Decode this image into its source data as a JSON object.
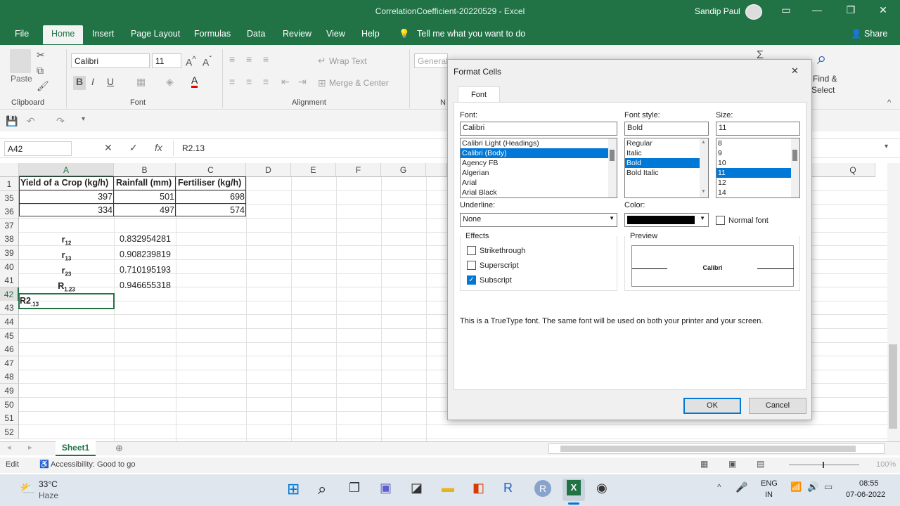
{
  "window": {
    "title": "CorrelationCoefficient-20220529  -  Excel",
    "user": "Sandip Paul"
  },
  "menu": {
    "tabs": [
      "File",
      "Home",
      "Insert",
      "Page Layout",
      "Formulas",
      "Data",
      "Review",
      "View",
      "Help"
    ],
    "tell_me": "Tell me what you want to do",
    "share": "Share"
  },
  "ribbon": {
    "paste": "Paste",
    "font_name": "Calibri",
    "font_size": "11",
    "wrap_text": "Wrap Text",
    "merge_center": "Merge & Center",
    "number_format": "General",
    "find_select_1": "Find &",
    "find_select_2": "Select",
    "groups": {
      "clipboard": "Clipboard",
      "font": "Font",
      "alignment": "Alignment",
      "number": "N"
    }
  },
  "formula_bar": {
    "name_box": "A42",
    "fx": "fx",
    "content": "R2.13"
  },
  "grid": {
    "columns": [
      "A",
      "B",
      "C",
      "D",
      "E",
      "F",
      "G",
      "Q"
    ],
    "row_numbers": [
      "1",
      "35",
      "36",
      "37",
      "38",
      "39",
      "40",
      "41",
      "42",
      "43",
      "44",
      "45",
      "46",
      "47",
      "48",
      "49",
      "50",
      "51",
      "52"
    ],
    "header_row": [
      "Yield of a Crop (kg/h)",
      "Rainfall (mm)",
      "Fertiliser (kg/h)"
    ],
    "rows": [
      [
        "397",
        "501",
        "698"
      ],
      [
        "334",
        "497",
        "574"
      ]
    ],
    "coefficients": [
      {
        "base": "r",
        "sub": "12",
        "value": "0.832954281"
      },
      {
        "base": "r",
        "sub": "13",
        "value": "0.908239819"
      },
      {
        "base": "r",
        "sub": "23",
        "value": "0.710195193"
      },
      {
        "base": "R",
        "sub": "1.23",
        "value": "0.946655318"
      }
    ],
    "active_cell": {
      "base": "R2",
      "sub": ".13"
    }
  },
  "sheet_tabs": [
    "Sheet1"
  ],
  "status": {
    "mode": "Edit",
    "accessibility": "Accessibility: Good to go",
    "zoom": "100%"
  },
  "taskbar": {
    "temp": "33°C",
    "weather": "Haze",
    "lang1": "ENG",
    "lang2": "IN",
    "time": "08:55",
    "date": "07-06-2022"
  },
  "dialog": {
    "title": "Format Cells",
    "tab": "Font",
    "font_label": "Font:",
    "font_value": "Calibri",
    "font_list": [
      "Calibri Light (Headings)",
      "Calibri (Body)",
      "Agency FB",
      "Algerian",
      "Arial",
      "Arial Black"
    ],
    "font_selected": 1,
    "style_label": "Font style:",
    "style_value": "Bold",
    "style_list": [
      "Regular",
      "Italic",
      "Bold",
      "Bold Italic"
    ],
    "style_selected": 2,
    "size_label": "Size:",
    "size_value": "11",
    "size_list": [
      "8",
      "9",
      "10",
      "11",
      "12",
      "14"
    ],
    "size_selected": 3,
    "underline_label": "Underline:",
    "underline_value": "None",
    "color_label": "Color:",
    "color_value": "#000000",
    "normal_font": "Normal font",
    "effects_label": "Effects",
    "strikethrough": "Strikethrough",
    "superscript": "Superscript",
    "subscript": "Subscript",
    "preview_label": "Preview",
    "preview_text": "Calibri",
    "info": "This is a TrueType font.  The same font will be used on both your printer and your screen.",
    "ok": "OK",
    "cancel": "Cancel"
  },
  "colors": {
    "excel_green": "#217346",
    "selection_blue": "#0078d7"
  }
}
